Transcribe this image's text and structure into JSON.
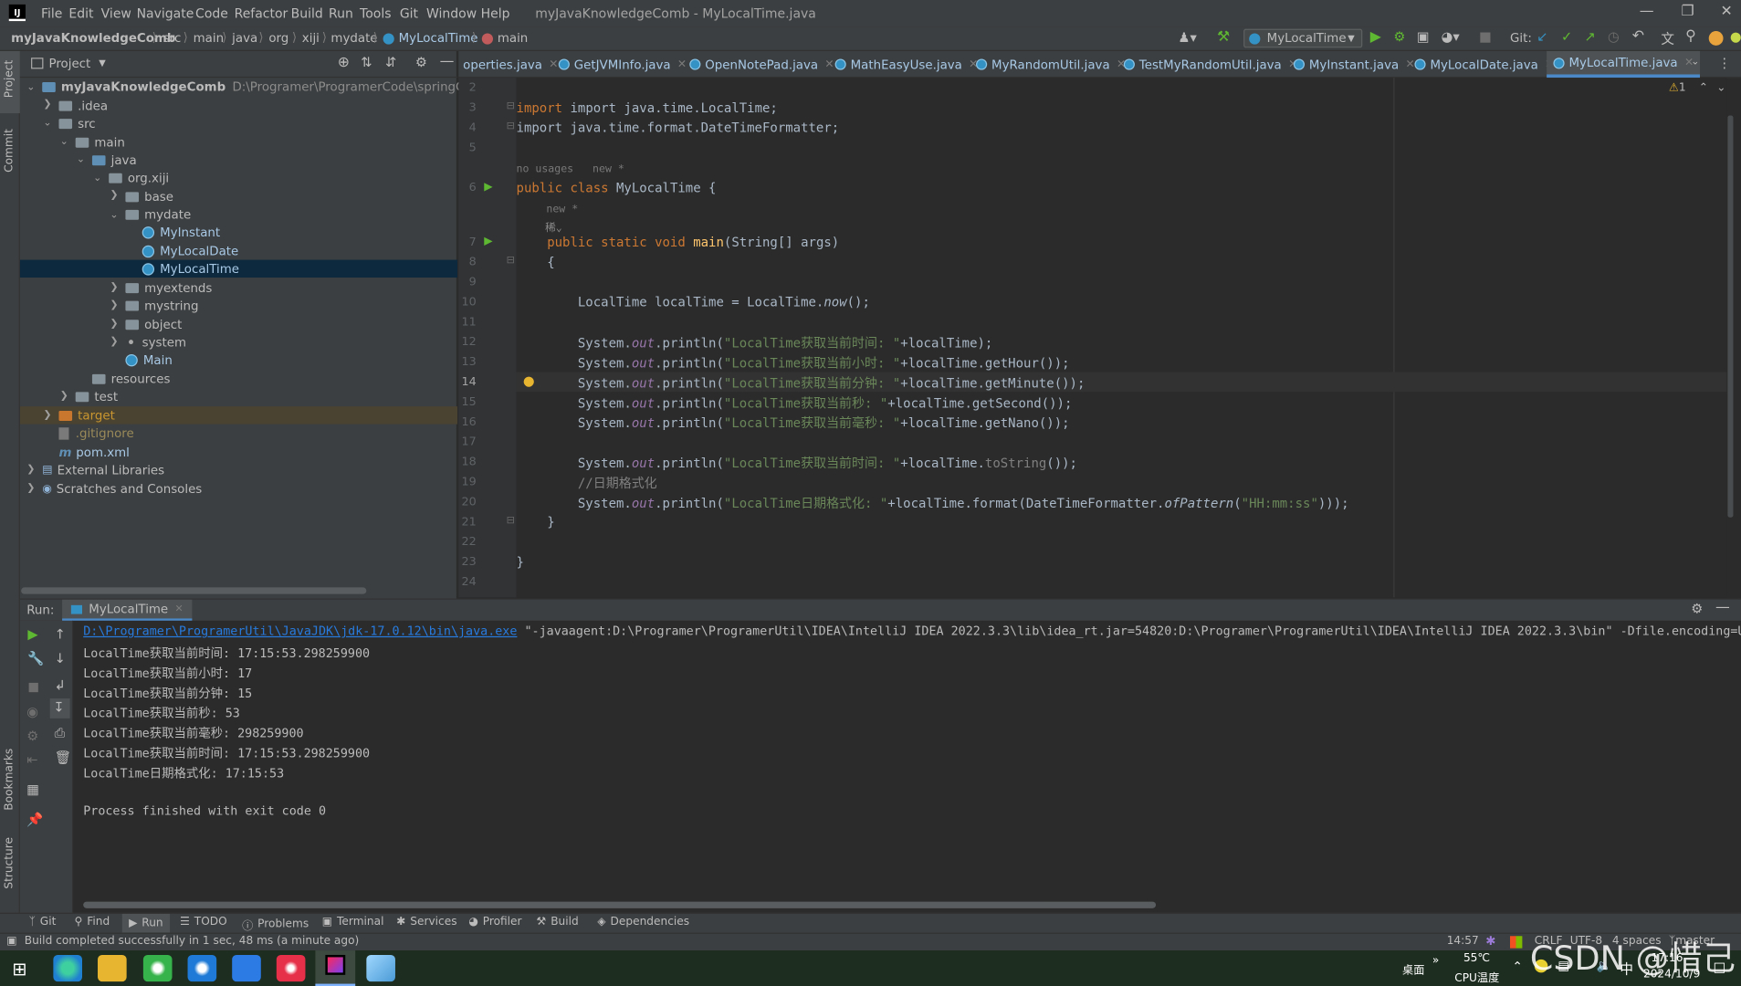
{
  "menu": [
    "File",
    "Edit",
    "View",
    "Navigate",
    "Code",
    "Refactor",
    "Build",
    "Run",
    "Tools",
    "Git",
    "Window",
    "Help"
  ],
  "window_title": "myJavaKnowledgeComb - MyLocalTime.java",
  "breadcrumbs": [
    "myJavaKnowledgeComb",
    "src",
    "main",
    "java",
    "org",
    "xiji",
    "mydate",
    "MyLocalTime",
    "main"
  ],
  "toolbar": {
    "run_config": "MyLocalTime",
    "git_label": "Git:"
  },
  "left_stripe": [
    "Project",
    "Commit",
    "Bookmarks",
    "Structure"
  ],
  "project": {
    "title": "Project",
    "root_name": "myJavaKnowledgeComb",
    "root_path": "D:\\Programer\\ProgramerCode\\springCloud\\my",
    "items": [
      ".idea",
      "src",
      "main",
      "java",
      "org.xiji",
      "base",
      "mydate",
      "MyInstant",
      "MyLocalDate",
      "MyLocalTime",
      "myextends",
      "mystring",
      "object",
      "system",
      "Main",
      "resources",
      "test",
      "target",
      ".gitignore",
      "pom.xml",
      "External Libraries",
      "Scratches and Consoles"
    ]
  },
  "tabs": [
    "operties.java",
    "GetJVMInfo.java",
    "OpenNotePad.java",
    "MathEasyUse.java",
    "MyRandomUtil.java",
    "TestMyRandomUtil.java",
    "MyInstant.java",
    "MyLocalDate.java",
    "MyLocalTime.java"
  ],
  "editor": {
    "warning_count": "1",
    "line_numbers": [
      "2",
      "3",
      "4",
      "5",
      "6",
      "7",
      "8",
      "9",
      "10",
      "11",
      "12",
      "13",
      "14",
      "15",
      "16",
      "17",
      "18",
      "19",
      "20",
      "21",
      "22",
      "23",
      "24"
    ],
    "hint_usages": "no usages",
    "hint_new": "new *",
    "hint_new2": "new *",
    "author_hint": "稀",
    "lines": {
      "l3": "import java.time.LocalTime;",
      "l4": "import java.time.format.DateTimeFormatter;",
      "l6a": "public class ",
      "l6b": "MyLocalTime {",
      "l7a": "    public static void ",
      "l7b": "main",
      "l7c": "(String[] args)",
      "l8": "    {",
      "l10a": "        LocalTime localTime = LocalTime.",
      "l10b": "now",
      "l10c": "();",
      "l12a": "        System.",
      "l12b": "out",
      "l12c": ".println(",
      "l12d": "\"LocalTime获取当前时间: \"",
      "l12e": "+localTime);",
      "l13a": "        System.",
      "l13b": "out",
      "l13c": ".println(",
      "l13d": "\"LocalTime获取当前小时: \"",
      "l13e": "+localTime.getHour());",
      "l14a": "        System.",
      "l14b": "out",
      "l14c": ".println(",
      "l14d": "\"LocalTime获取当前分钟: \"",
      "l14e": "+localTime.getMinute());",
      "l15a": "        System.",
      "l15b": "out",
      "l15c": ".println(",
      "l15d": "\"LocalTime获取当前秒: \"",
      "l15e": "+localTime.getSecond());",
      "l16a": "        System.",
      "l16b": "out",
      "l16c": ".println(",
      "l16d": "\"LocalTime获取当前毫秒: \"",
      "l16e": "+localTime.getNano());",
      "l18a": "        System.",
      "l18b": "out",
      "l18c": ".println(",
      "l18d": "\"LocalTime获取当前时间: \"",
      "l18e": "+localTime.",
      "l18f": "toString",
      "l18g": "());",
      "l19": "        //日期格式化",
      "l20a": "        System.",
      "l20b": "out",
      "l20c": ".println(",
      "l20d": "\"LocalTime日期格式化: \"",
      "l20e": "+localTime.format(DateTimeFormatter.",
      "l20f": "ofPattern",
      "l20g": "(",
      "l20h": "\"HH:mm:ss\"",
      "l20i": ")));",
      "l21": "    }",
      "l23": "}"
    }
  },
  "run": {
    "label": "Run:",
    "tab": "MyLocalTime",
    "cmd_link": "D:\\Programer\\ProgramerUtil\\JavaJDK\\jdk-17.0.12\\bin\\java.exe",
    "cmd_rest": " \"-javaagent:D:\\Programer\\ProgramerUtil\\IDEA\\IntelliJ IDEA 2022.3.3\\lib\\idea_rt.jar=54820:D:\\Programer\\ProgramerUtil\\IDEA\\IntelliJ IDEA 2022.3.3\\bin\" -Dfile.encoding=U",
    "output": [
      "LocalTime获取当前时间: 17:15:53.298259900",
      "LocalTime获取当前小时: 17",
      "LocalTime获取当前分钟: 15",
      "LocalTime获取当前秒: 53",
      "LocalTime获取当前毫秒: 298259900",
      "LocalTime获取当前时间: 17:15:53.298259900",
      "LocalTime日期格式化: 17:15:53"
    ],
    "finished": "Process finished with exit code 0"
  },
  "bottom_tools": [
    "Git",
    "Find",
    "Run",
    "TODO",
    "Problems",
    "Terminal",
    "Services",
    "Profiler",
    "Build",
    "Dependencies"
  ],
  "status": {
    "message": "Build completed successfully in 1 sec, 48 ms (a minute ago)",
    "position": "14:57",
    "line_sep": "CRLF",
    "encoding": "UTF-8",
    "indent": "4 spaces",
    "branch": "master"
  },
  "taskbar": {
    "desktop": "桌面",
    "temp": "55℃",
    "temp_label": "CPU温度",
    "ime": "中",
    "time": "17:16",
    "date": "2024/10/9",
    "watermark": "CSDN @惜己"
  },
  "colors": {
    "keyword": "#cc7832",
    "string": "#6a8759",
    "field": "#9876aa",
    "function": "#ffc66d",
    "comment": "#808080",
    "link": "#287bde",
    "selection": "#0d293e"
  }
}
